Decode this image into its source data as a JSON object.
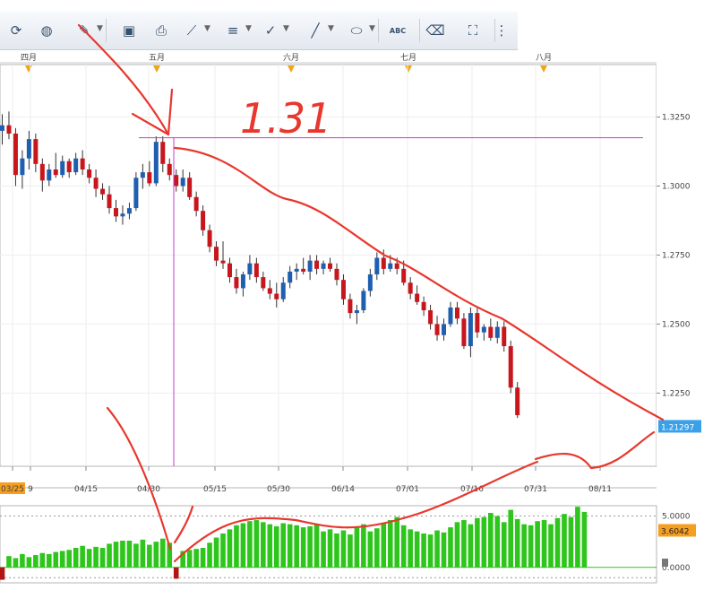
{
  "toolbar": {
    "buttons": [
      {
        "icon": "refresh-icon"
      },
      {
        "icon": "globe-icon"
      },
      {
        "icon": "ruler-icon"
      },
      {
        "icon": "image-icon"
      },
      {
        "icon": "print-icon"
      },
      {
        "icon": "trend-line-icon"
      },
      {
        "icon": "fibonacci-icon"
      },
      {
        "icon": "pen-icon"
      },
      {
        "icon": "brush-icon"
      },
      {
        "icon": "ellipse-icon"
      },
      {
        "icon": "text-label-icon",
        "label": "ABC"
      },
      {
        "icon": "eraser-icon"
      },
      {
        "icon": "hierarchy-icon"
      },
      {
        "icon": "overflow-menu-icon"
      }
    ]
  },
  "colors": {
    "bull": "#1f5fb0",
    "bear": "#c8161d",
    "volume": "#2ec51c",
    "volume_neg": "#b31414",
    "crosshair": "#c83cc8",
    "annotation": "#e8382e",
    "price_tag": "#3aa0e8",
    "volume_tag": "#f59e20"
  },
  "chart_data": [
    {
      "type": "candlestick",
      "top_axis_months": [
        "四月",
        "五月",
        "六月",
        "七月",
        "八月"
      ],
      "x_tick_labels": [
        "03/25",
        "9",
        "04/15",
        "04/30",
        "05/15",
        "05/30",
        "06/14",
        "07/01",
        "07/16",
        "07/31",
        "08/11"
      ],
      "y_tick_labels": [
        "1.3250",
        "1.3000",
        "1.2750",
        "1.2500",
        "1.2250"
      ],
      "ylim": [
        1.1985,
        1.344
      ],
      "current_price_label": "1.21297",
      "crosshair_price": 1.3175,
      "annotation_text": "1.31",
      "candles": [
        [
          1.32,
          1.326,
          1.315,
          1.322
        ],
        [
          1.322,
          1.327,
          1.317,
          1.319
        ],
        [
          1.319,
          1.321,
          1.3,
          1.304
        ],
        [
          1.304,
          1.313,
          1.299,
          1.31
        ],
        [
          1.31,
          1.32,
          1.306,
          1.317
        ],
        [
          1.317,
          1.319,
          1.305,
          1.308
        ],
        [
          1.308,
          1.31,
          1.298,
          1.302
        ],
        [
          1.302,
          1.308,
          1.3,
          1.306
        ],
        [
          1.306,
          1.312,
          1.303,
          1.304
        ],
        [
          1.304,
          1.311,
          1.303,
          1.309
        ],
        [
          1.309,
          1.31,
          1.303,
          1.305
        ],
        [
          1.305,
          1.312,
          1.304,
          1.31
        ],
        [
          1.31,
          1.313,
          1.304,
          1.306
        ],
        [
          1.306,
          1.308,
          1.301,
          1.303
        ],
        [
          1.303,
          1.306,
          1.296,
          1.299
        ],
        [
          1.299,
          1.301,
          1.295,
          1.297
        ],
        [
          1.297,
          1.3,
          1.29,
          1.292
        ],
        [
          1.292,
          1.295,
          1.287,
          1.289
        ],
        [
          1.289,
          1.293,
          1.286,
          1.29
        ],
        [
          1.29,
          1.294,
          1.288,
          1.292
        ],
        [
          1.292,
          1.305,
          1.291,
          1.303
        ],
        [
          1.303,
          1.308,
          1.299,
          1.305
        ],
        [
          1.305,
          1.309,
          1.3,
          1.301
        ],
        [
          1.301,
          1.318,
          1.3,
          1.316
        ],
        [
          1.316,
          1.318,
          1.305,
          1.308
        ],
        [
          1.308,
          1.31,
          1.302,
          1.304
        ],
        [
          1.304,
          1.306,
          1.298,
          1.3
        ],
        [
          1.3,
          1.306,
          1.298,
          1.303
        ],
        [
          1.303,
          1.305,
          1.295,
          1.296
        ],
        [
          1.296,
          1.298,
          1.289,
          1.291
        ],
        [
          1.291,
          1.293,
          1.282,
          1.284
        ],
        [
          1.284,
          1.286,
          1.276,
          1.278
        ],
        [
          1.278,
          1.28,
          1.271,
          1.273
        ],
        [
          1.273,
          1.28,
          1.27,
          1.272
        ],
        [
          1.272,
          1.274,
          1.265,
          1.267
        ],
        [
          1.267,
          1.27,
          1.261,
          1.263
        ],
        [
          1.263,
          1.269,
          1.26,
          1.268
        ],
        [
          1.268,
          1.275,
          1.266,
          1.272
        ],
        [
          1.272,
          1.274,
          1.265,
          1.267
        ],
        [
          1.267,
          1.269,
          1.262,
          1.263
        ],
        [
          1.263,
          1.266,
          1.259,
          1.261
        ],
        [
          1.261,
          1.265,
          1.256,
          1.259
        ],
        [
          1.259,
          1.267,
          1.258,
          1.265
        ],
        [
          1.265,
          1.271,
          1.263,
          1.269
        ],
        [
          1.269,
          1.272,
          1.266,
          1.27
        ],
        [
          1.27,
          1.274,
          1.268,
          1.269
        ],
        [
          1.269,
          1.275,
          1.266,
          1.273
        ],
        [
          1.273,
          1.275,
          1.268,
          1.27
        ],
        [
          1.27,
          1.273,
          1.268,
          1.272
        ],
        [
          1.272,
          1.274,
          1.269,
          1.27
        ],
        [
          1.27,
          1.272,
          1.264,
          1.266
        ],
        [
          1.266,
          1.268,
          1.257,
          1.259
        ],
        [
          1.259,
          1.261,
          1.252,
          1.254
        ],
        [
          1.254,
          1.257,
          1.25,
          1.255
        ],
        [
          1.255,
          1.263,
          1.254,
          1.262
        ],
        [
          1.262,
          1.27,
          1.26,
          1.268
        ],
        [
          1.268,
          1.276,
          1.266,
          1.274
        ],
        [
          1.274,
          1.277,
          1.268,
          1.27
        ],
        [
          1.27,
          1.275,
          1.269,
          1.272
        ],
        [
          1.272,
          1.274,
          1.268,
          1.27
        ],
        [
          1.27,
          1.273,
          1.264,
          1.265
        ],
        [
          1.265,
          1.267,
          1.259,
          1.261
        ],
        [
          1.261,
          1.264,
          1.257,
          1.258
        ],
        [
          1.258,
          1.26,
          1.253,
          1.255
        ],
        [
          1.255,
          1.257,
          1.248,
          1.25
        ],
        [
          1.25,
          1.253,
          1.244,
          1.246
        ],
        [
          1.246,
          1.252,
          1.244,
          1.25
        ],
        [
          1.25,
          1.258,
          1.249,
          1.256
        ],
        [
          1.256,
          1.258,
          1.25,
          1.252
        ],
        [
          1.252,
          1.254,
          1.241,
          1.242
        ],
        [
          1.242,
          1.256,
          1.238,
          1.254
        ],
        [
          1.254,
          1.256,
          1.245,
          1.247
        ],
        [
          1.247,
          1.25,
          1.244,
          1.249
        ],
        [
          1.249,
          1.252,
          1.244,
          1.245
        ],
        [
          1.245,
          1.251,
          1.243,
          1.249
        ],
        [
          1.249,
          1.251,
          1.24,
          1.242
        ],
        [
          1.242,
          1.244,
          1.225,
          1.227
        ],
        [
          1.227,
          1.229,
          1.216,
          1.217
        ]
      ]
    },
    {
      "type": "bar",
      "series_kind": "indicator",
      "y_tick_labels": [
        "5.0000",
        "0.0000"
      ],
      "ylim": [
        -1.5,
        6.0
      ],
      "current_value_label": "3.6042",
      "values": [
        -1.2,
        1.1,
        0.9,
        1.3,
        1.0,
        1.2,
        1.4,
        1.3,
        1.5,
        1.6,
        1.7,
        1.9,
        2.1,
        1.8,
        2.0,
        1.9,
        2.3,
        2.5,
        2.6,
        2.6,
        2.3,
        2.7,
        2.2,
        2.5,
        2.8,
        2.4,
        -1.1,
        1.6,
        1.7,
        1.8,
        1.9,
        2.4,
        2.9,
        3.3,
        3.7,
        4.1,
        4.3,
        4.5,
        4.6,
        4.4,
        4.2,
        4.0,
        4.3,
        4.2,
        4.1,
        3.9,
        4.0,
        4.2,
        3.5,
        3.7,
        3.3,
        3.6,
        3.2,
        3.9,
        4.2,
        3.5,
        3.8,
        4.3,
        4.6,
        4.9,
        4.1,
        3.7,
        3.5,
        3.3,
        3.2,
        3.6,
        3.4,
        3.9,
        4.4,
        4.6,
        4.2,
        4.8,
        4.9,
        5.3,
        5.0,
        4.4,
        5.6,
        4.7,
        4.2,
        4.1,
        4.5,
        4.6,
        4.2,
        4.8,
        5.2,
        4.9,
        5.9,
        5.4
      ]
    }
  ]
}
